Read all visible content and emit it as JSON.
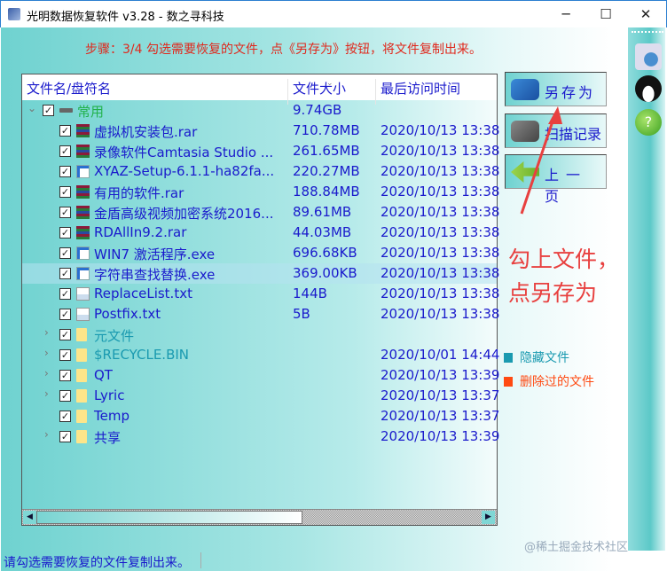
{
  "window": {
    "title": "光明数据恢复软件 v3.28 - 数之寻科技",
    "minimize": "─",
    "maximize": "☐",
    "close": "✕"
  },
  "step_text": "步骤：3/4 勾选需要恢复的文件，点《另存为》按钮，将文件复制出来。",
  "columns": {
    "name": "文件名/盘符名",
    "size": "文件大小",
    "time": "最后访问时间"
  },
  "rows": [
    {
      "level": 0,
      "expand": "⌄",
      "icon": "drive",
      "name": "常用",
      "size": "9.74GB",
      "time": "",
      "color": "#22b24c"
    },
    {
      "level": 1,
      "icon": "rar",
      "name": "虚拟机安装包.rar",
      "size": "710.78MB",
      "time": "2020/10/13 13:38"
    },
    {
      "level": 1,
      "icon": "rar",
      "name": "录像软件Camtasia Studio ...",
      "size": "261.65MB",
      "time": "2020/10/13 13:38"
    },
    {
      "level": 1,
      "icon": "exe",
      "name": "XYAZ-Setup-6.1.1-ha82fa...",
      "size": "220.27MB",
      "time": "2020/10/13 13:38"
    },
    {
      "level": 1,
      "icon": "rar",
      "name": "有用的软件.rar",
      "size": "188.84MB",
      "time": "2020/10/13 13:38"
    },
    {
      "level": 1,
      "icon": "rar",
      "name": "金盾高级视频加密系统2016...",
      "size": "89.61MB",
      "time": "2020/10/13 13:38"
    },
    {
      "level": 1,
      "icon": "rar",
      "name": "RDAllIn9.2.rar",
      "size": "44.03MB",
      "time": "2020/10/13 13:38"
    },
    {
      "level": 1,
      "icon": "exe",
      "name": "WIN7 激活程序.exe",
      "size": "696.68KB",
      "time": "2020/10/13 13:38"
    },
    {
      "level": 1,
      "icon": "exe",
      "name": "字符串查找替换.exe",
      "size": "369.00KB",
      "time": "2020/10/13 13:38",
      "selected": true
    },
    {
      "level": 1,
      "icon": "txt",
      "name": "ReplaceList.txt",
      "size": "144B",
      "time": "2020/10/13 13:38"
    },
    {
      "level": 1,
      "icon": "txt",
      "name": "Postfix.txt",
      "size": "5B",
      "time": "2020/10/13 13:38"
    },
    {
      "level": 1,
      "expand": "›",
      "icon": "folder",
      "name": "元文件",
      "size": "",
      "time": "",
      "color": "#1a9ab0"
    },
    {
      "level": 1,
      "expand": "›",
      "icon": "folder",
      "name": "$RECYCLE.BIN",
      "size": "",
      "time": "2020/10/01 14:44",
      "color": "#1a9ab0"
    },
    {
      "level": 1,
      "expand": "›",
      "icon": "folder",
      "name": "QT",
      "size": "",
      "time": "2020/10/13 13:39"
    },
    {
      "level": 1,
      "expand": "›",
      "icon": "folder",
      "name": "Lyric",
      "size": "",
      "time": "2020/10/13 13:37"
    },
    {
      "level": 1,
      "icon": "folder",
      "name": "Temp",
      "size": "",
      "time": "2020/10/13 13:37"
    },
    {
      "level": 1,
      "expand": "›",
      "icon": "folder",
      "name": "共享",
      "size": "",
      "time": "2020/10/13 13:39"
    }
  ],
  "buttons": {
    "save_as": "另存为",
    "scan_record": "扫描记录",
    "prev_page": "上一页"
  },
  "legend": [
    {
      "label": "隐藏文件",
      "color": "#1a9ab0"
    },
    {
      "label": "删除过的文件",
      "color": "#ff4a12"
    }
  ],
  "annotation": {
    "line1": "勾上文件，",
    "line2": "点另存为"
  },
  "status": "请勾选需要恢复的文件复制出来。",
  "watermark": "@稀土掘金技术社区",
  "check": "✓"
}
